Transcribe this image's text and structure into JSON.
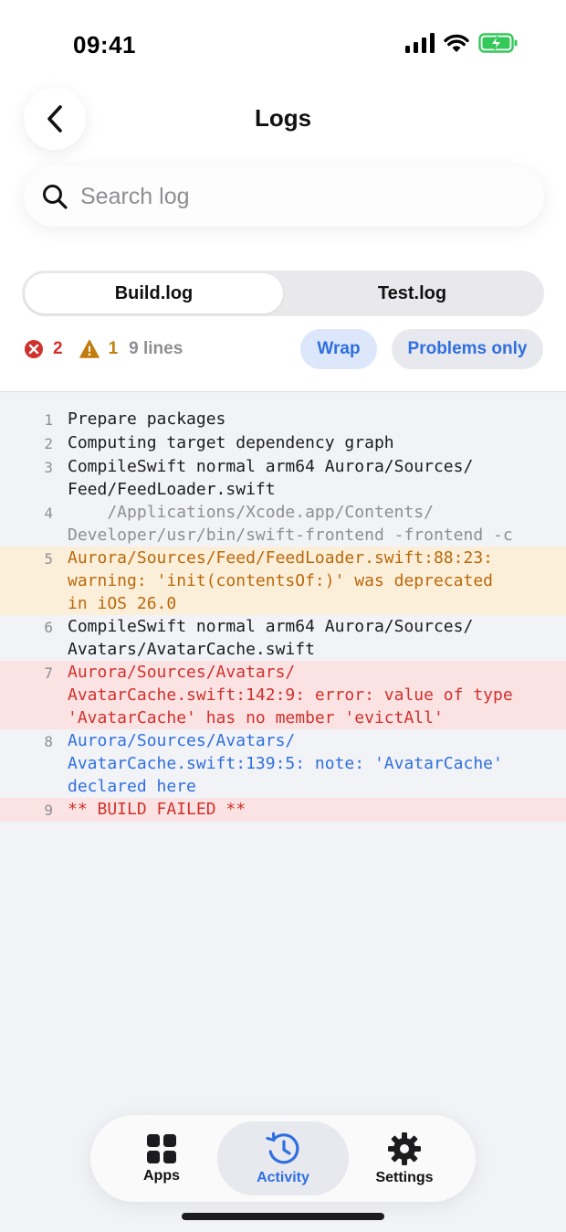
{
  "status": {
    "time": "09:41"
  },
  "header": {
    "title": "Logs"
  },
  "search": {
    "placeholder": "Search log",
    "value": ""
  },
  "segments": [
    {
      "label": "Build.log",
      "selected": true
    },
    {
      "label": "Test.log",
      "selected": false
    }
  ],
  "summary": {
    "errors": "2",
    "warnings": "1",
    "lines": "9 lines"
  },
  "filters": {
    "wrap": "Wrap",
    "problems_only": "Problems only"
  },
  "log": [
    {
      "n": "1",
      "kind": "normal",
      "text": "Prepare packages"
    },
    {
      "n": "2",
      "kind": "normal",
      "text": "Computing target dependency graph"
    },
    {
      "n": "3",
      "kind": "normal",
      "text": "CompileSwift normal arm64 Aurora/Sources/\nFeed/FeedLoader.swift"
    },
    {
      "n": "4",
      "kind": "cmd",
      "text": "    /Applications/Xcode.app/Contents/\nDeveloper/usr/bin/swift-frontend -frontend -c"
    },
    {
      "n": "5",
      "kind": "warning",
      "text": "Aurora/Sources/Feed/FeedLoader.swift:88:23:\nwarning: 'init(contentsOf:)' was deprecated\nin iOS 26.0"
    },
    {
      "n": "6",
      "kind": "normal",
      "text": "CompileSwift normal arm64 Aurora/Sources/\nAvatars/AvatarCache.swift"
    },
    {
      "n": "7",
      "kind": "error",
      "text": "Aurora/Sources/Avatars/\nAvatarCache.swift:142:9: error: value of type\n'AvatarCache' has no member 'evictAll'"
    },
    {
      "n": "8",
      "kind": "note",
      "text": "Aurora/Sources/Avatars/\nAvatarCache.swift:139:5: note: 'AvatarCache'\ndeclared here"
    },
    {
      "n": "9",
      "kind": "error",
      "text": "** BUILD FAILED **"
    }
  ],
  "tabs": [
    {
      "label": "Apps",
      "icon": "apps-grid-icon"
    },
    {
      "label": "Activity",
      "icon": "activity-clock-icon",
      "active": true
    },
    {
      "label": "Settings",
      "icon": "gear-icon"
    }
  ],
  "colors": {
    "accent": "#2f6fe0",
    "error": "#d0312d",
    "warning": "#c17d0e",
    "battery": "#34c759"
  }
}
